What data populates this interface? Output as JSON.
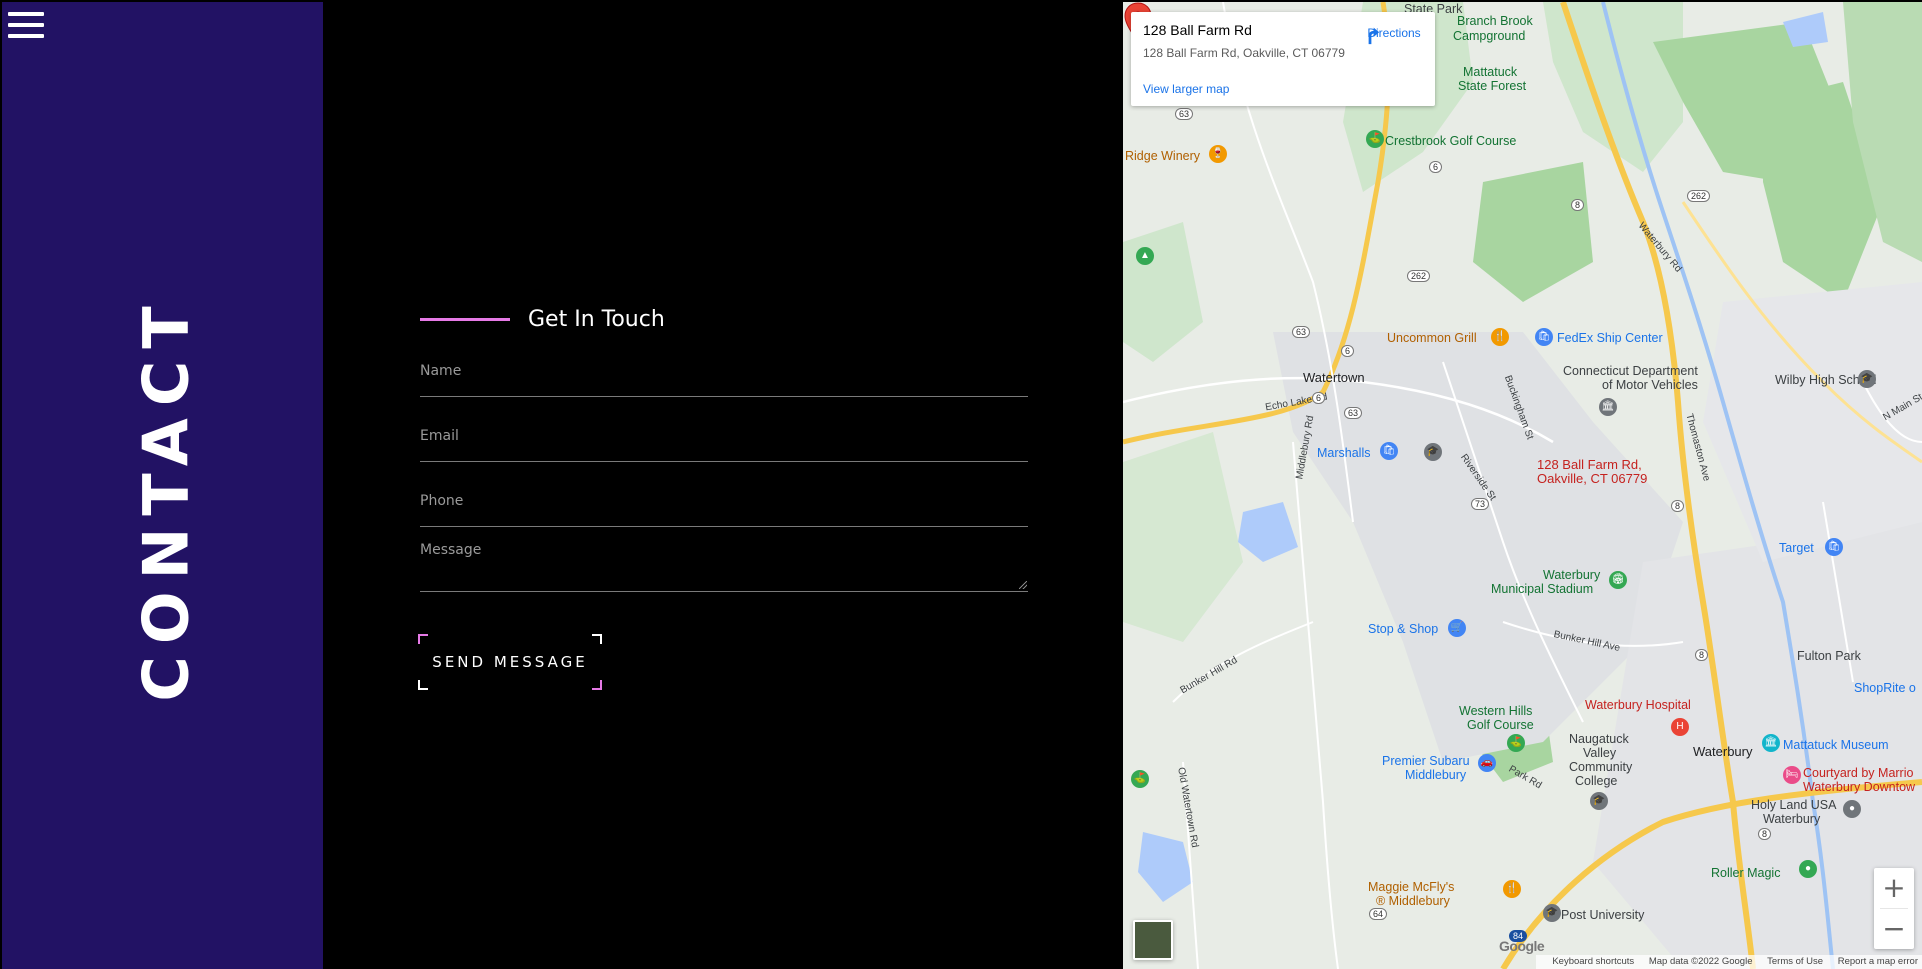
{
  "sidebar": {
    "title": "CONTACT"
  },
  "form": {
    "heading": "Get In Touch",
    "name_placeholder": "Name",
    "email_placeholder": "Email",
    "phone_placeholder": "Phone",
    "message_placeholder": "Message",
    "submit_label": "SEND MESSAGE",
    "accent_color": "#e67ae6",
    "panel_color": "#221264"
  },
  "map": {
    "card": {
      "title": "128 Ball Farm Rd",
      "address": "128 Ball Farm Rd, Oakville, CT 06779",
      "directions_label": "Directions",
      "larger_map_label": "View larger map"
    },
    "marker_label_line1": "128 Ball Farm Rd,",
    "marker_label_line2": "Oakville, CT 06779",
    "places": {
      "state_park": "State Park",
      "branch_brook": "Branch Brook",
      "campground": "Campground",
      "mattatuck": "Mattatuck",
      "state_forest": "State Forest",
      "crestbrook": "Crestbrook Golf Course",
      "ridge_winery": "Ridge Winery",
      "uncommon_grill": "Uncommon Grill",
      "fedex": "FedEx Ship Center",
      "watertown": "Watertown",
      "dmv1": "Connecticut Department",
      "dmv2": "of Motor Vehicles",
      "wilby": "Wilby High School",
      "marshalls": "Marshalls",
      "target": "Target",
      "waterbury_stadium1": "Waterbury",
      "waterbury_stadium2": "Municipal Stadium",
      "stop_shop": "Stop & Shop",
      "fulton_park": "Fulton Park",
      "shoprite": "ShopRite o",
      "western_hills1": "Western Hills",
      "western_hills2": "Golf Course",
      "waterbury_hospital": "Waterbury Hospital",
      "mattatuck_museum": "Mattatuck Museum",
      "premier1": "Premier Subaru",
      "premier2": "Middlebury",
      "naugatuck1": "Naugatuck",
      "naugatuck2": "Valley",
      "naugatuck3": "Community",
      "naugatuck4": "College",
      "waterbury": "Waterbury",
      "courtyard1": "Courtyard by Marrio",
      "courtyard2": "Waterbury Downtow",
      "holyland1": "Holy Land USA",
      "holyland2": "Waterbury",
      "roller": "Roller Magic",
      "maggie1": "Maggie McFly's",
      "maggie2": "® Middlebury",
      "post": "Post University"
    },
    "streets": {
      "echo_lake": "Echo Lake Rd",
      "middlebury": "Middlebury Rd",
      "riverside": "Riverside St",
      "buckingham": "Buckingham St",
      "thomaston": "Thomaston Ave",
      "waterbury_rd": "Waterbury Rd",
      "bunker": "Bunker Hill Rd",
      "bunker_ave": "Bunker Hill Ave",
      "old_watertown": "Old Watertown Rd",
      "park_rd": "Park Rd",
      "n_main": "N Main St"
    },
    "shields": [
      "63",
      "6",
      "262",
      "8",
      "63",
      "6",
      "6",
      "63",
      "262",
      "73",
      "8",
      "8",
      "8",
      "64",
      "84"
    ],
    "google_label": "Google",
    "attribution": {
      "keyboard": "Keyboard shortcuts",
      "map_data": "Map data ©2022 Google",
      "terms": "Terms of Use",
      "report": "Report a map error"
    }
  }
}
